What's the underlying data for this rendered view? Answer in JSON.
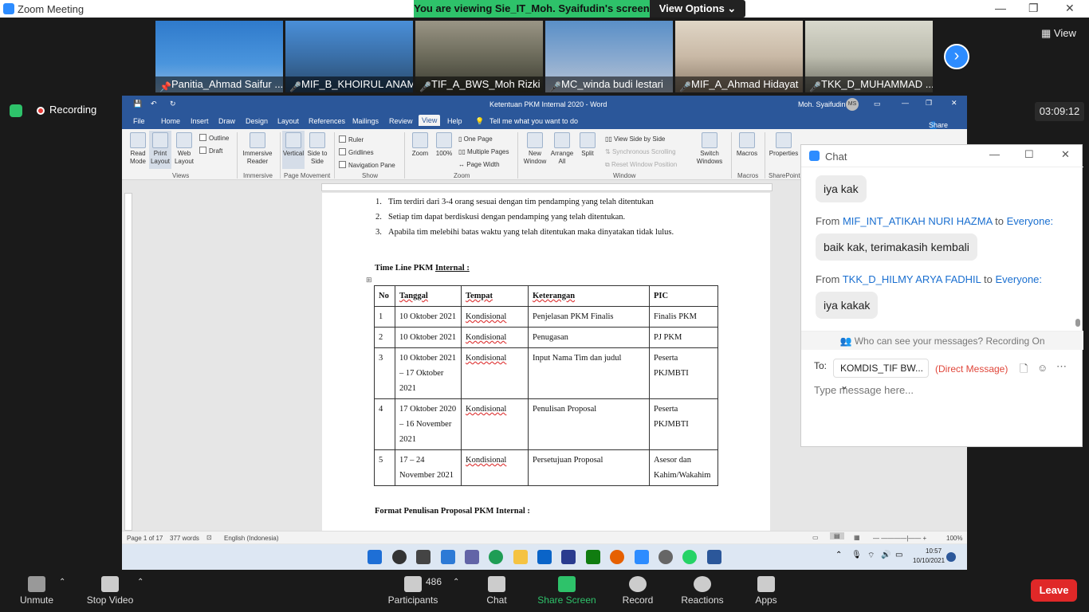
{
  "zoom": {
    "window_title": "Zoom Meeting",
    "banner": "You are viewing Sie_IT_Moh. Syaifudin's screen",
    "view_options": "View Options ⌄",
    "view_label": "View",
    "recording": "Recording",
    "timer": "03:09:12",
    "participants": [
      {
        "name": "Panitia_Ahmad Saifur ...",
        "color": "#3b7fc4",
        "muted": false
      },
      {
        "name": "MIF_B_KHOIRUL ANAM",
        "color": "#4a90d9",
        "muted": true
      },
      {
        "name": "TIF_A_BWS_Moh Rizki ...",
        "color": "#6b6a5a",
        "muted": true
      },
      {
        "name": "MC_winda budi lestari",
        "color": "#5a8fc7",
        "muted": true
      },
      {
        "name": "MIF_A_Ahmad Hidayat",
        "color": "#c9b9a6",
        "muted": true
      },
      {
        "name": "TKK_D_MUHAMMAD ...",
        "color": "#bcbcae",
        "muted": true
      }
    ],
    "bottom": {
      "unmute": "Unmute",
      "stop_video": "Stop Video",
      "participants": "Participants",
      "participant_count": "486",
      "chat": "Chat",
      "share_screen": "Share Screen",
      "record": "Record",
      "reactions": "Reactions",
      "apps": "Apps",
      "leave": "Leave"
    }
  },
  "word": {
    "title": "Ketentuan PKM Internal 2020  -  Word",
    "user": "Moh. Syaifudin",
    "user_initials": "MS",
    "tabs": [
      "File",
      "Home",
      "Insert",
      "Draw",
      "Design",
      "Layout",
      "References",
      "Mailings",
      "Review",
      "View",
      "Help"
    ],
    "tell_me": "Tell me what you want to do",
    "share": "Share",
    "ribbon": {
      "read_mode": "Read Mode",
      "print_layout": "Print Layout",
      "web_layout": "Web Layout",
      "outline": "Outline",
      "draft": "Draft",
      "views": "Views",
      "immersive_reader": "Immersive Reader",
      "immersive": "Immersive",
      "vertical": "Vertical",
      "side_to_side": "Side to Side",
      "page_movement": "Page Movement",
      "ruler": "Ruler",
      "gridlines": "Gridlines",
      "navigation_pane": "Navigation Pane",
      "show": "Show",
      "zoom": "Zoom",
      "pct100": "100%",
      "one_page": "One Page",
      "multiple_pages": "Multiple Pages",
      "page_width": "Page Width",
      "zoom_grp": "Zoom",
      "new_window": "New Window",
      "arrange_all": "Arrange All",
      "split": "Split",
      "view_side_by_side": "View Side by Side",
      "synchronous_scrolling": "Synchronous Scrolling",
      "reset_window_position": "Reset Window Position",
      "switch_windows": "Switch Windows",
      "window": "Window",
      "macros": "Macros",
      "macros_grp": "Macros",
      "properties": "Properties",
      "sharepoint": "SharePoint"
    },
    "doc": {
      "list": [
        {
          "n": "1.",
          "text": "Tim terdiri dari 3-4 orang sesuai dengan tim pendamping yang telah ditentukan"
        },
        {
          "n": "2.",
          "text": "Setiap tim dapat berdiskusi dengan pendamping yang telah ditentukan."
        },
        {
          "n": "3.",
          "text": "Apabila tim melebihi batas waktu yang telah ditentukan maka dinyatakan tidak lulus."
        }
      ],
      "heading1_a": "Time Line PKM ",
      "heading1_b": "Internal :",
      "table_head": [
        "No",
        "Tanggal",
        "Tempat",
        "Keterangan",
        "PIC"
      ],
      "table_rows": [
        [
          "1",
          "10 Oktober 2021",
          "Kondisional",
          "Penjelasan PKM Finalis",
          "Finalis PKM"
        ],
        [
          "2",
          "10 Oktober 2021",
          "Kondisional",
          "Penugasan",
          "PJ PKM"
        ],
        [
          "3",
          "10 Oktober 2021 – 17 Oktober 2021",
          "Kondisional",
          "Input Nama Tim dan judul",
          "Peserta PKJMBTI"
        ],
        [
          "4",
          "17 Oktober 2020 – 16 November 2021",
          "Kondisional",
          "Penulisan Proposal",
          "Peserta PKJMBTI"
        ],
        [
          "5",
          "17 – 24 November 2021",
          "Kondisional",
          "Persetujuan Proposal",
          "Asesor dan Kahim/Wakahim"
        ]
      ],
      "heading2": "Format Penulisan Proposal PKM Internal :"
    },
    "status": {
      "page": "Page 1 of 17",
      "words": "377 words",
      "language": "English (Indonesia)",
      "zoom": "100%"
    },
    "taskbar": {
      "time": "10:57",
      "date": "10/10/2021"
    }
  },
  "chat": {
    "title": "Chat",
    "messages": [
      {
        "from": "",
        "to": "",
        "text": "iya kak"
      },
      {
        "from": "MIF_INT_ATIKAH NURI HAZMA",
        "to": "Everyone:",
        "text": "baik kak, terimakasih kembali"
      },
      {
        "from": "TKK_D_HILMY ARYA FADHIL",
        "to": "Everyone:",
        "text": "iya kakak"
      }
    ],
    "from_label": "From",
    "to_word": "to",
    "notice": "Who can see your messages? Recording On",
    "to_label": "To:",
    "recipient": "KOMDIS_TIF BW...",
    "direct": "(Direct Message)",
    "placeholder": "Type message here..."
  }
}
